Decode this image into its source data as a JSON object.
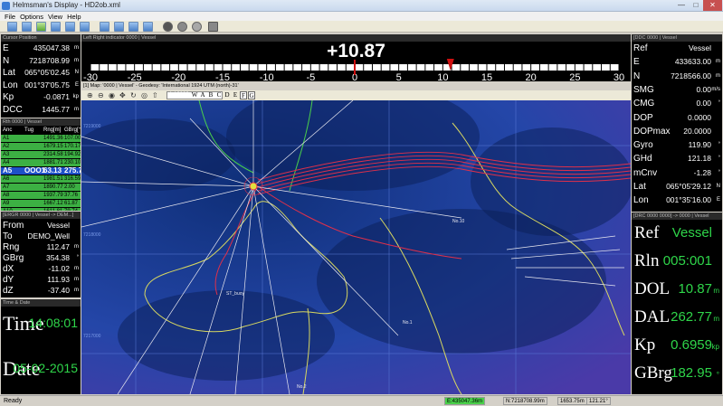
{
  "window": {
    "title": "Helmsman's Display - HD2ob.xml"
  },
  "menu": [
    "File",
    "Options",
    "View",
    "Help"
  ],
  "cursor_panel": {
    "header": "Cursor Position",
    "rows": [
      {
        "k": "E",
        "v": "435047.38",
        "u": "m"
      },
      {
        "k": "N",
        "v": "7218708.99",
        "u": "m"
      },
      {
        "k": "Lat",
        "v": "065°05'02.45",
        "u": "N"
      },
      {
        "k": "Lon",
        "v": "001°37'05.75",
        "u": "E"
      },
      {
        "k": "Kp",
        "v": "-0.0871",
        "u": "kp"
      },
      {
        "k": "DCC",
        "v": "1445.77",
        "u": "m"
      }
    ]
  },
  "anchor_panel": {
    "header": "Rth 0000 | Vessel",
    "columns": [
      "Anc",
      "Tug",
      "Rng[m]",
      "GBrg[°]"
    ],
    "rows": [
      {
        "anc": "A1",
        "tug": "",
        "rng": "1491.36",
        "brg": "107.00"
      },
      {
        "anc": "A2",
        "tug": "",
        "rng": "1679.15",
        "brg": "170.17"
      },
      {
        "anc": "A3",
        "tug": "",
        "rng": "2314.58",
        "brg": "194.92"
      },
      {
        "anc": "A4",
        "tug": "",
        "rng": "1881.71",
        "brg": "230.10"
      },
      {
        "anc": "A5",
        "tug": "OOO1",
        "rng": "63.13",
        "brg": "275.77"
      },
      {
        "anc": "A6",
        "tug": "",
        "rng": "1981.51",
        "brg": "316.59"
      },
      {
        "anc": "A7",
        "tug": "",
        "rng": "1890.77",
        "brg": "2.00"
      },
      {
        "anc": "A8",
        "tug": "",
        "rng": "1937.79",
        "brg": "37.76"
      },
      {
        "anc": "A9",
        "tug": "",
        "rng": "1667.12",
        "brg": "61.87"
      },
      {
        "anc": "A10",
        "tug": "",
        "rng": "1611.81",
        "brg": "79.74"
      }
    ],
    "selected_index": 4
  },
  "target_panel": {
    "header": "[ERGR 0000 | Vessel -> DEM...]",
    "rows": [
      {
        "k": "From",
        "v": "Vessel",
        "u": ""
      },
      {
        "k": "To",
        "v": "DEMO_Well",
        "u": ""
      },
      {
        "k": "Rng",
        "v": "112.47",
        "u": "m"
      },
      {
        "k": "GBrg",
        "v": "354.38",
        "u": "°"
      },
      {
        "k": "dX",
        "v": "-11.02",
        "u": "m"
      },
      {
        "k": "dY",
        "v": "111.93",
        "u": "m"
      },
      {
        "k": "dZ",
        "v": "-37.40",
        "u": "m"
      }
    ]
  },
  "time_panel": {
    "header": "Time & Date",
    "time_label": "Time",
    "time_value": "14:08:01",
    "date_label": "Date",
    "date_value": "05-02-2015"
  },
  "lr_indicator": {
    "header": "Left Right indicator 0000 | Vessel",
    "value": "+10.87",
    "ticks": [
      "-30",
      "-25",
      "-20",
      "-15",
      "-10",
      "-5",
      "0",
      "5",
      "10",
      "15",
      "20",
      "25",
      "30"
    ],
    "min": -30,
    "max": 30,
    "pointer": 10.87
  },
  "map": {
    "header": "[1] Map: '0000 | Vessel' - Geodesy: 'International 1924 UTM (north)-31'",
    "scale": "1:12000",
    "letters": [
      "W",
      "A",
      "B",
      "C",
      "D",
      "E",
      "F",
      "G"
    ],
    "labels": [
      "No.10",
      "No.1",
      "No.2",
      "ST_buoy"
    ],
    "grid_labels": [
      "7219000",
      "7218000",
      "7217000"
    ]
  },
  "vessel_panel": {
    "header": "[DDC 0000 | Vessel",
    "rows": [
      {
        "k": "Ref",
        "v": "Vessel",
        "u": ""
      },
      {
        "k": "E",
        "v": "433633.00",
        "u": "m"
      },
      {
        "k": "N",
        "v": "7218566.00",
        "u": "m"
      },
      {
        "k": "SMG",
        "v": "0.00",
        "u": "m/s"
      },
      {
        "k": "CMG",
        "v": "0.00",
        "u": "°"
      },
      {
        "k": "DOP",
        "v": "0.0000",
        "u": ""
      },
      {
        "k": "DOPmax",
        "v": "20.0000",
        "u": ""
      },
      {
        "k": "Gyro",
        "v": "119.90",
        "u": "°"
      },
      {
        "k": "GHd",
        "v": "121.18",
        "u": "°"
      },
      {
        "k": "mCnv",
        "v": "-1.28",
        "u": "°"
      },
      {
        "k": "Lat",
        "v": "065°05'29.12",
        "u": "N"
      },
      {
        "k": "Lon",
        "v": "001°35'16.00",
        "u": "E"
      }
    ]
  },
  "route_panel": {
    "header": "[DRC 0000 0000] -> 0000 | Vessel",
    "rows": [
      {
        "k": "Ref",
        "v": "Vessel",
        "u": ""
      },
      {
        "k": "Rln",
        "v": "005:001",
        "u": ""
      },
      {
        "k": "DOL",
        "v": "10.87",
        "u": "m"
      },
      {
        "k": "DAL",
        "v": "262.77",
        "u": "m"
      },
      {
        "k": "Kp",
        "v": "0.6959",
        "u": "kp"
      },
      {
        "k": "GBrg",
        "v": "182.95",
        "u": "°"
      }
    ]
  },
  "status": {
    "ready": "Ready",
    "boxes": [
      "E:435047.36m",
      "N:7218708.99m",
      "1653.75m",
      "121.21°"
    ]
  },
  "colors": {
    "accent_green": "#2fd64a",
    "selected_blue": "#1e50c8",
    "row_green": "#3cb043",
    "pointer_red": "#d01010"
  }
}
